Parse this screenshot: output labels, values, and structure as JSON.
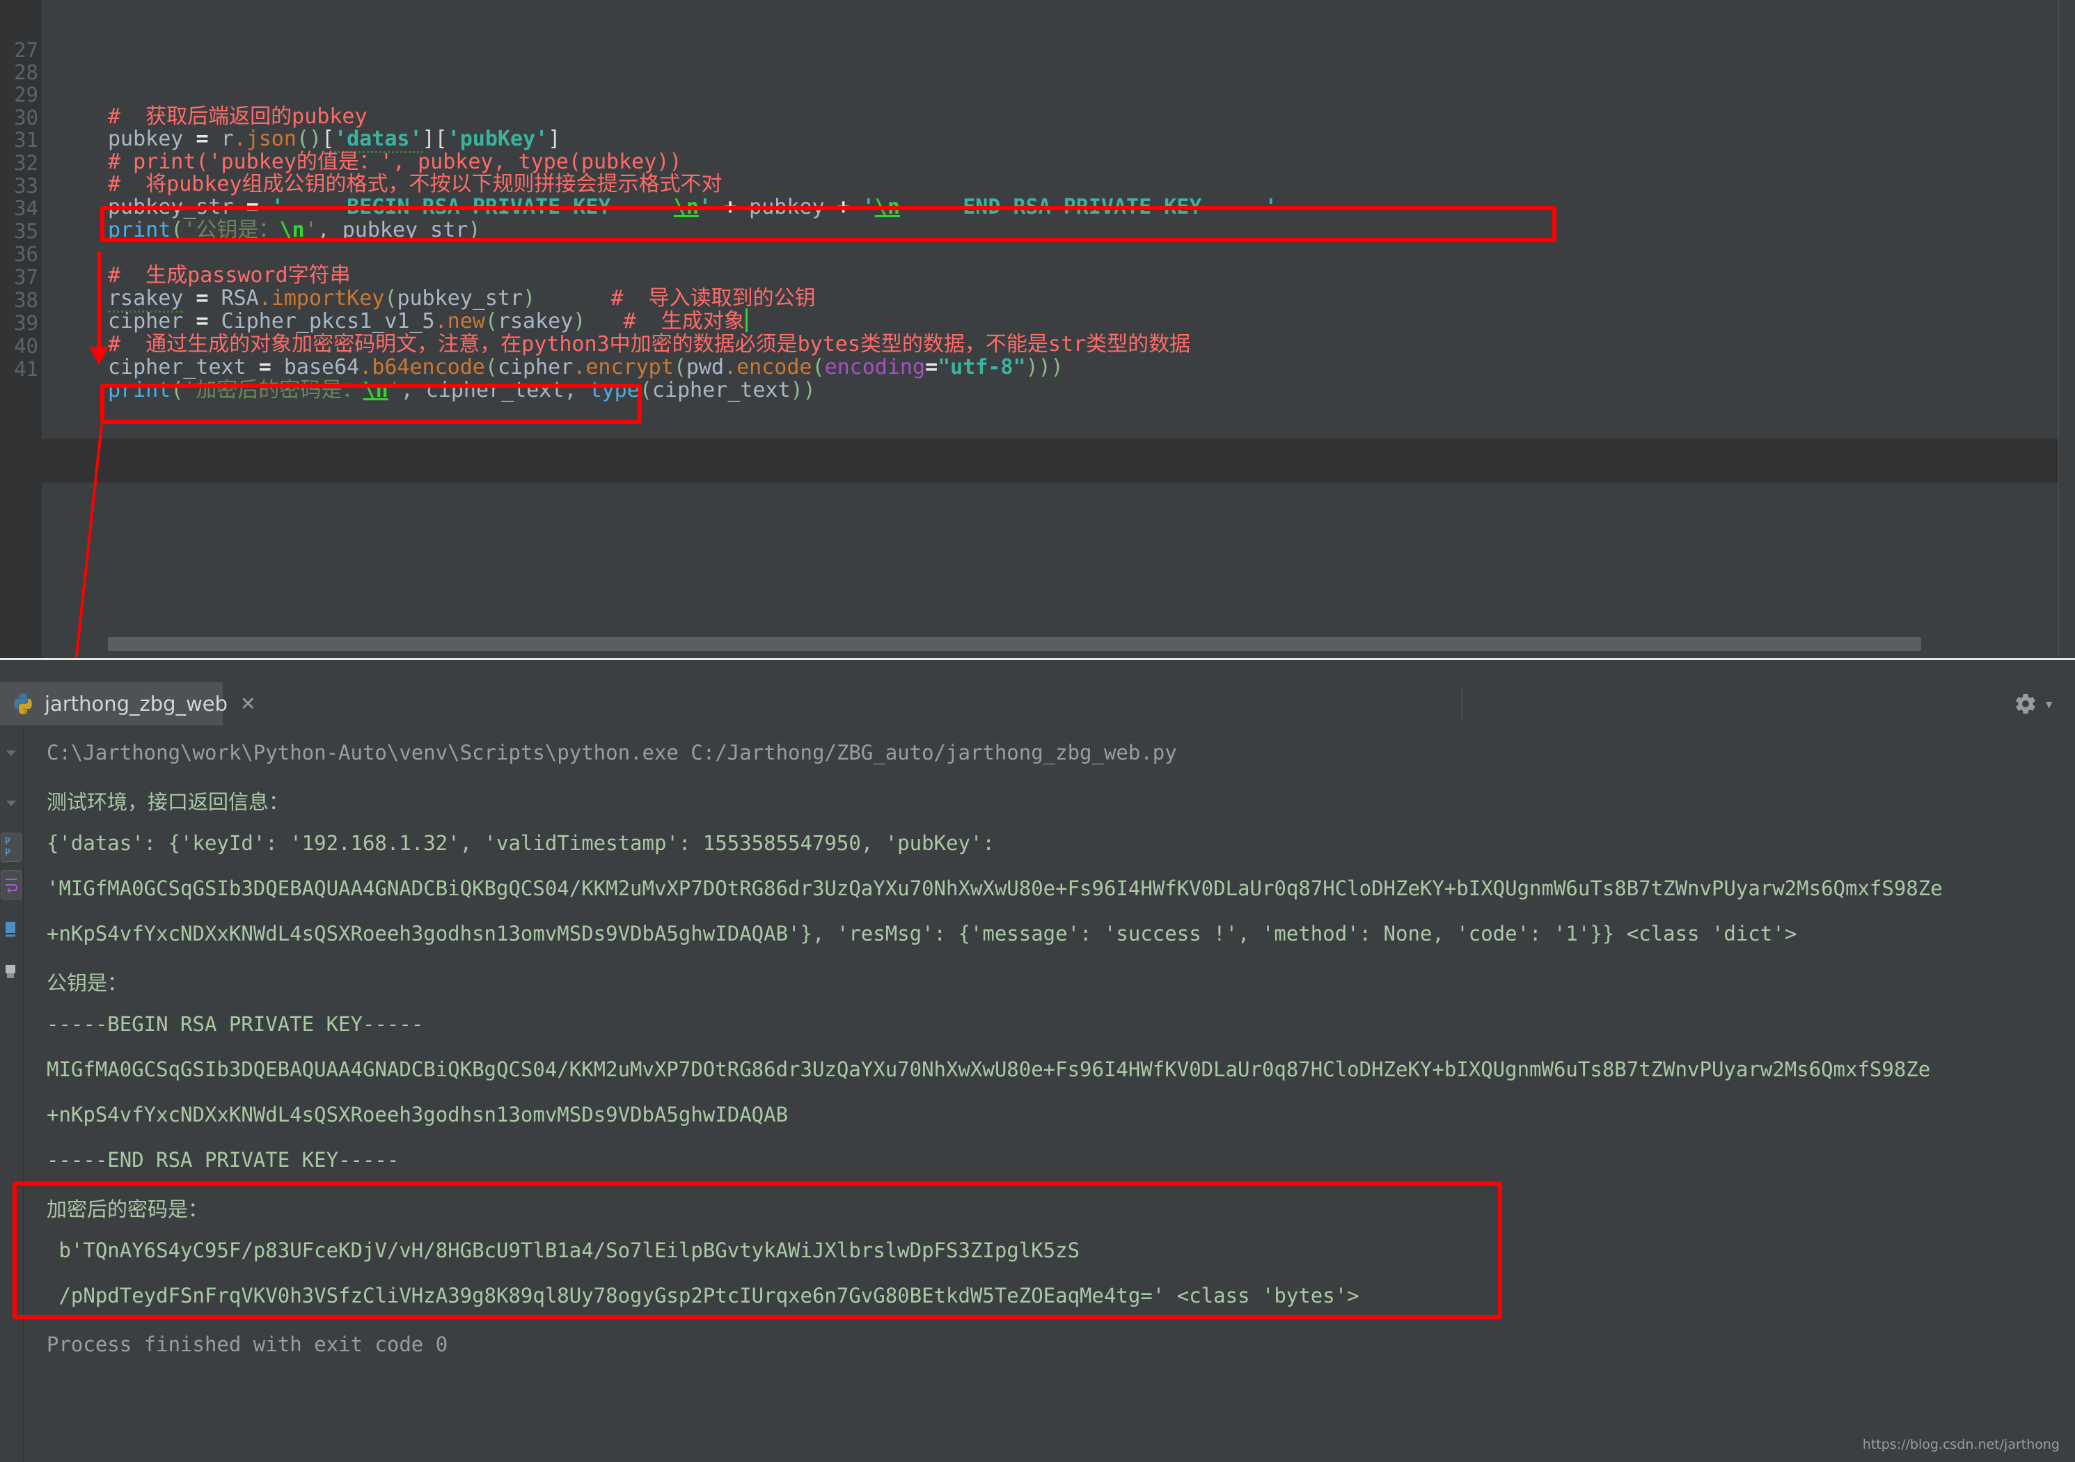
{
  "editor": {
    "lines": [
      {
        "num": "27",
        "text": ""
      },
      {
        "num": "28",
        "text": "#  获取后端返回的pubkey"
      },
      {
        "num": "29",
        "text": "pubkey = r.json()['datas']['pubKey']"
      },
      {
        "num": "30",
        "text": "# print('pubkey的值是：', pubkey, type(pubkey))"
      },
      {
        "num": "31",
        "text": "#  将pubkey组成公钥的格式，不按以下规则拼接会提示格式不对"
      },
      {
        "num": "32",
        "text": "pubkey_str = '-----BEGIN RSA PRIVATE KEY-----\\n' + pubkey + '\\n-----END RSA PRIVATE KEY-----'"
      },
      {
        "num": "33",
        "text": "print('公钥是：\\n', pubkey_str)"
      },
      {
        "num": "34",
        "text": ""
      },
      {
        "num": "35",
        "text": "#  生成password字符串"
      },
      {
        "num": "36",
        "text": "rsakey = RSA.importKey(pubkey_str)      #  导入读取到的公钥"
      },
      {
        "num": "37",
        "text": "cipher = Cipher_pkcs1_v1_5.new(rsakey)   #  生成对象"
      },
      {
        "num": "38",
        "text": "#  通过生成的对象加密密码明文，注意，在python3中加密的数据必须是bytes类型的数据，不能是str类型的数据"
      },
      {
        "num": "39",
        "text": "cipher_text = base64.b64encode(cipher.encrypt(pwd.encode(encoding=\"utf-8\")))"
      },
      {
        "num": "40",
        "text": "print('加密后的密码是：\\n', cipher_text, type(cipher_text))"
      },
      {
        "num": "41",
        "text": ""
      }
    ],
    "l28_comment": "#  获取后端返回的pubkey",
    "l29": {
      "var": "pubkey",
      "eq": "=",
      "obj": "r",
      "dot": ".",
      "json": "json",
      "parens": "()",
      "b1": "[",
      "s1": "'datas'",
      "b2": "]",
      "b3": "[",
      "s2": "'pubKey'",
      "b4": "]"
    },
    "l30_comment": "# print('pubkey的值是：', pubkey, type(pubkey))",
    "l31_comment": "#  将pubkey组成公钥的格式，不按以下规则拼接会提示格式不对",
    "l32": {
      "var": "pubkey_str",
      "eq": "=",
      "q1": "'",
      "begin": "-----BEGIN RSA PRIVATE KEY-----",
      "esc1": "\\n",
      "q2": "'",
      "plus1": "+",
      "mid": "pubkey",
      "plus2": "+",
      "q3": "'",
      "esc2": "\\n",
      "end": "-----END RSA PRIVATE KEY-----",
      "q4": "'"
    },
    "l33": {
      "fn": "print",
      "p1": "(",
      "q1": "'",
      "cn": "公钥是：",
      "esc": "\\n",
      "q2": "'",
      "comma": ", ",
      "arg": "pubkey_str",
      "p2": ")"
    },
    "l35_comment": "#  生成password字符串",
    "l36": {
      "var": "rsakey",
      "eq": "=",
      "mod": "RSA",
      "dot": ".",
      "fn": "importKey",
      "p1": "(",
      "arg": "pubkey_str",
      "p2": ")",
      "comment": "#  导入读取到的公钥"
    },
    "l37": {
      "var": "cipher",
      "eq": "=",
      "mod": "Cipher_pkcs1_v1_5",
      "dot": ".",
      "fn": "new",
      "p1": "(",
      "arg": "rsakey",
      "p2": ")",
      "comment": "#  生成对象"
    },
    "l38_comment": "#  通过生成的对象加密密码明文，注意，在python3中加密的数据必须是bytes类型的数据，不能是str类型的数据",
    "l39": {
      "var": "cipher_text",
      "eq": "=",
      "mod": "base64",
      "dot": ".",
      "fn": "b64encode",
      "p1": "(",
      "obj2": "cipher",
      "dot2": ".",
      "fn2": "encrypt",
      "p2": "(",
      "obj3": "pwd",
      "dot3": ".",
      "fn3": "encode",
      "p3": "(",
      "kw": "encoding",
      "kweq": "=",
      "kwval": "\"utf-8\"",
      "close": ")))"
    },
    "l40": {
      "fn": "print",
      "p1": "(",
      "q1": "'",
      "cn": "加密后的密码是：",
      "esc": "\\n",
      "q2": "'",
      "comma": ", ",
      "a1": "cipher_text",
      "comma2": ", ",
      "tfn": "type",
      "p2": "(",
      "a2": "cipher_text",
      "p3": "))"
    }
  },
  "console": {
    "tab": {
      "label": "jarthong_zbg_web",
      "close": "✕",
      "icon": "python-icon"
    },
    "gear": {
      "icon": "gear-icon",
      "chevron": "▾"
    },
    "output": [
      {
        "id": "cmd",
        "style": "grey",
        "text": "C:\\Jarthong\\work\\Python-Auto\\venv\\Scripts\\python.exe C:/Jarthong/ZBG_auto/jarthong_zbg_web.py"
      },
      {
        "id": "env",
        "style": "green",
        "text": "测试环境，接口返回信息："
      },
      {
        "id": "json1",
        "style": "green",
        "text": "{'datas': {'keyId': '192.168.1.32', 'validTimestamp': 1553585547950, 'pubKey':"
      },
      {
        "id": "json2",
        "style": "green",
        "text": "'MIGfMA0GCSqGSIb3DQEBAQUAA4GNADCBiQKBgQCS04/KKM2uMvXP7DOtRG86dr3UzQaYXu70NhXwXwU80e+Fs96I4HWfKV0DLaUr0q87HCloDHZeKY+bIXQUgnmW6uTs8B7tZWnvPUyarw2Ms6QmxfS98Ze"
      },
      {
        "id": "json3",
        "style": "green",
        "text": "+nKpS4vfYxcNDXxKNWdL4sQSXRoeeh3godhsn13omvMSDs9VDbA5ghwIDAQAB'}, 'resMsg': {'message': 'success !', 'method': None, 'code': '1'}} <class 'dict'>"
      },
      {
        "id": "pub",
        "style": "green",
        "text": "公钥是："
      },
      {
        "id": "kbeg",
        "style": "green",
        "text": "-----BEGIN RSA PRIVATE KEY-----"
      },
      {
        "id": "kb1",
        "style": "green",
        "text": "MIGfMA0GCSqGSIb3DQEBAQUAA4GNADCBiQKBgQCS04/KKM2uMvXP7DOtRG86dr3UzQaYXu70NhXwXwU80e+Fs96I4HWfKV0DLaUr0q87HCloDHZeKY+bIXQUgnmW6uTs8B7tZWnvPUyarw2Ms6QmxfS98Ze"
      },
      {
        "id": "kb2",
        "style": "green",
        "text": "+nKpS4vfYxcNDXxKNWdL4sQSXRoeeh3godhsn13omvMSDs9VDbA5ghwIDAQAB"
      },
      {
        "id": "kend",
        "style": "green",
        "text": "-----END RSA PRIVATE KEY-----"
      },
      {
        "id": "enc",
        "style": "green",
        "text": "加密后的密码是："
      },
      {
        "id": "enc1",
        "style": "green",
        "text": " b'TQnAY6S4yC95F/p83UFceKDjV/vH/8HGBcU9TlB1a4/So7lEilpBGvtykAWiJXlbrslwDpFS3ZIpglK5zS"
      },
      {
        "id": "enc2",
        "style": "green",
        "text": " /pNpdTeydFSnFrqVKV0h3VSfzCliVHzA39g8K89ql8Uy78ogyGsp2PtcIUrqxe6n7GvG80BEtkdW5TeZOEaqMe4tg=' <class 'bytes'>"
      },
      {
        "id": "done",
        "style": "grey",
        "text": "Process finished with exit code 0"
      }
    ]
  },
  "watermark": "https://blog.csdn.net/jarthong",
  "colors": {
    "annotation_red": "#ff0000",
    "editor_bg": "#3c3f41",
    "gutter_bg": "#313335",
    "console_text_green": "#a9c9a4",
    "console_text_grey": "#9c9c9c",
    "string_green": "#6a8759",
    "comment_red": "#ff6b68",
    "keyword_orange": "#cc7832",
    "highlight_line": "#323232"
  }
}
